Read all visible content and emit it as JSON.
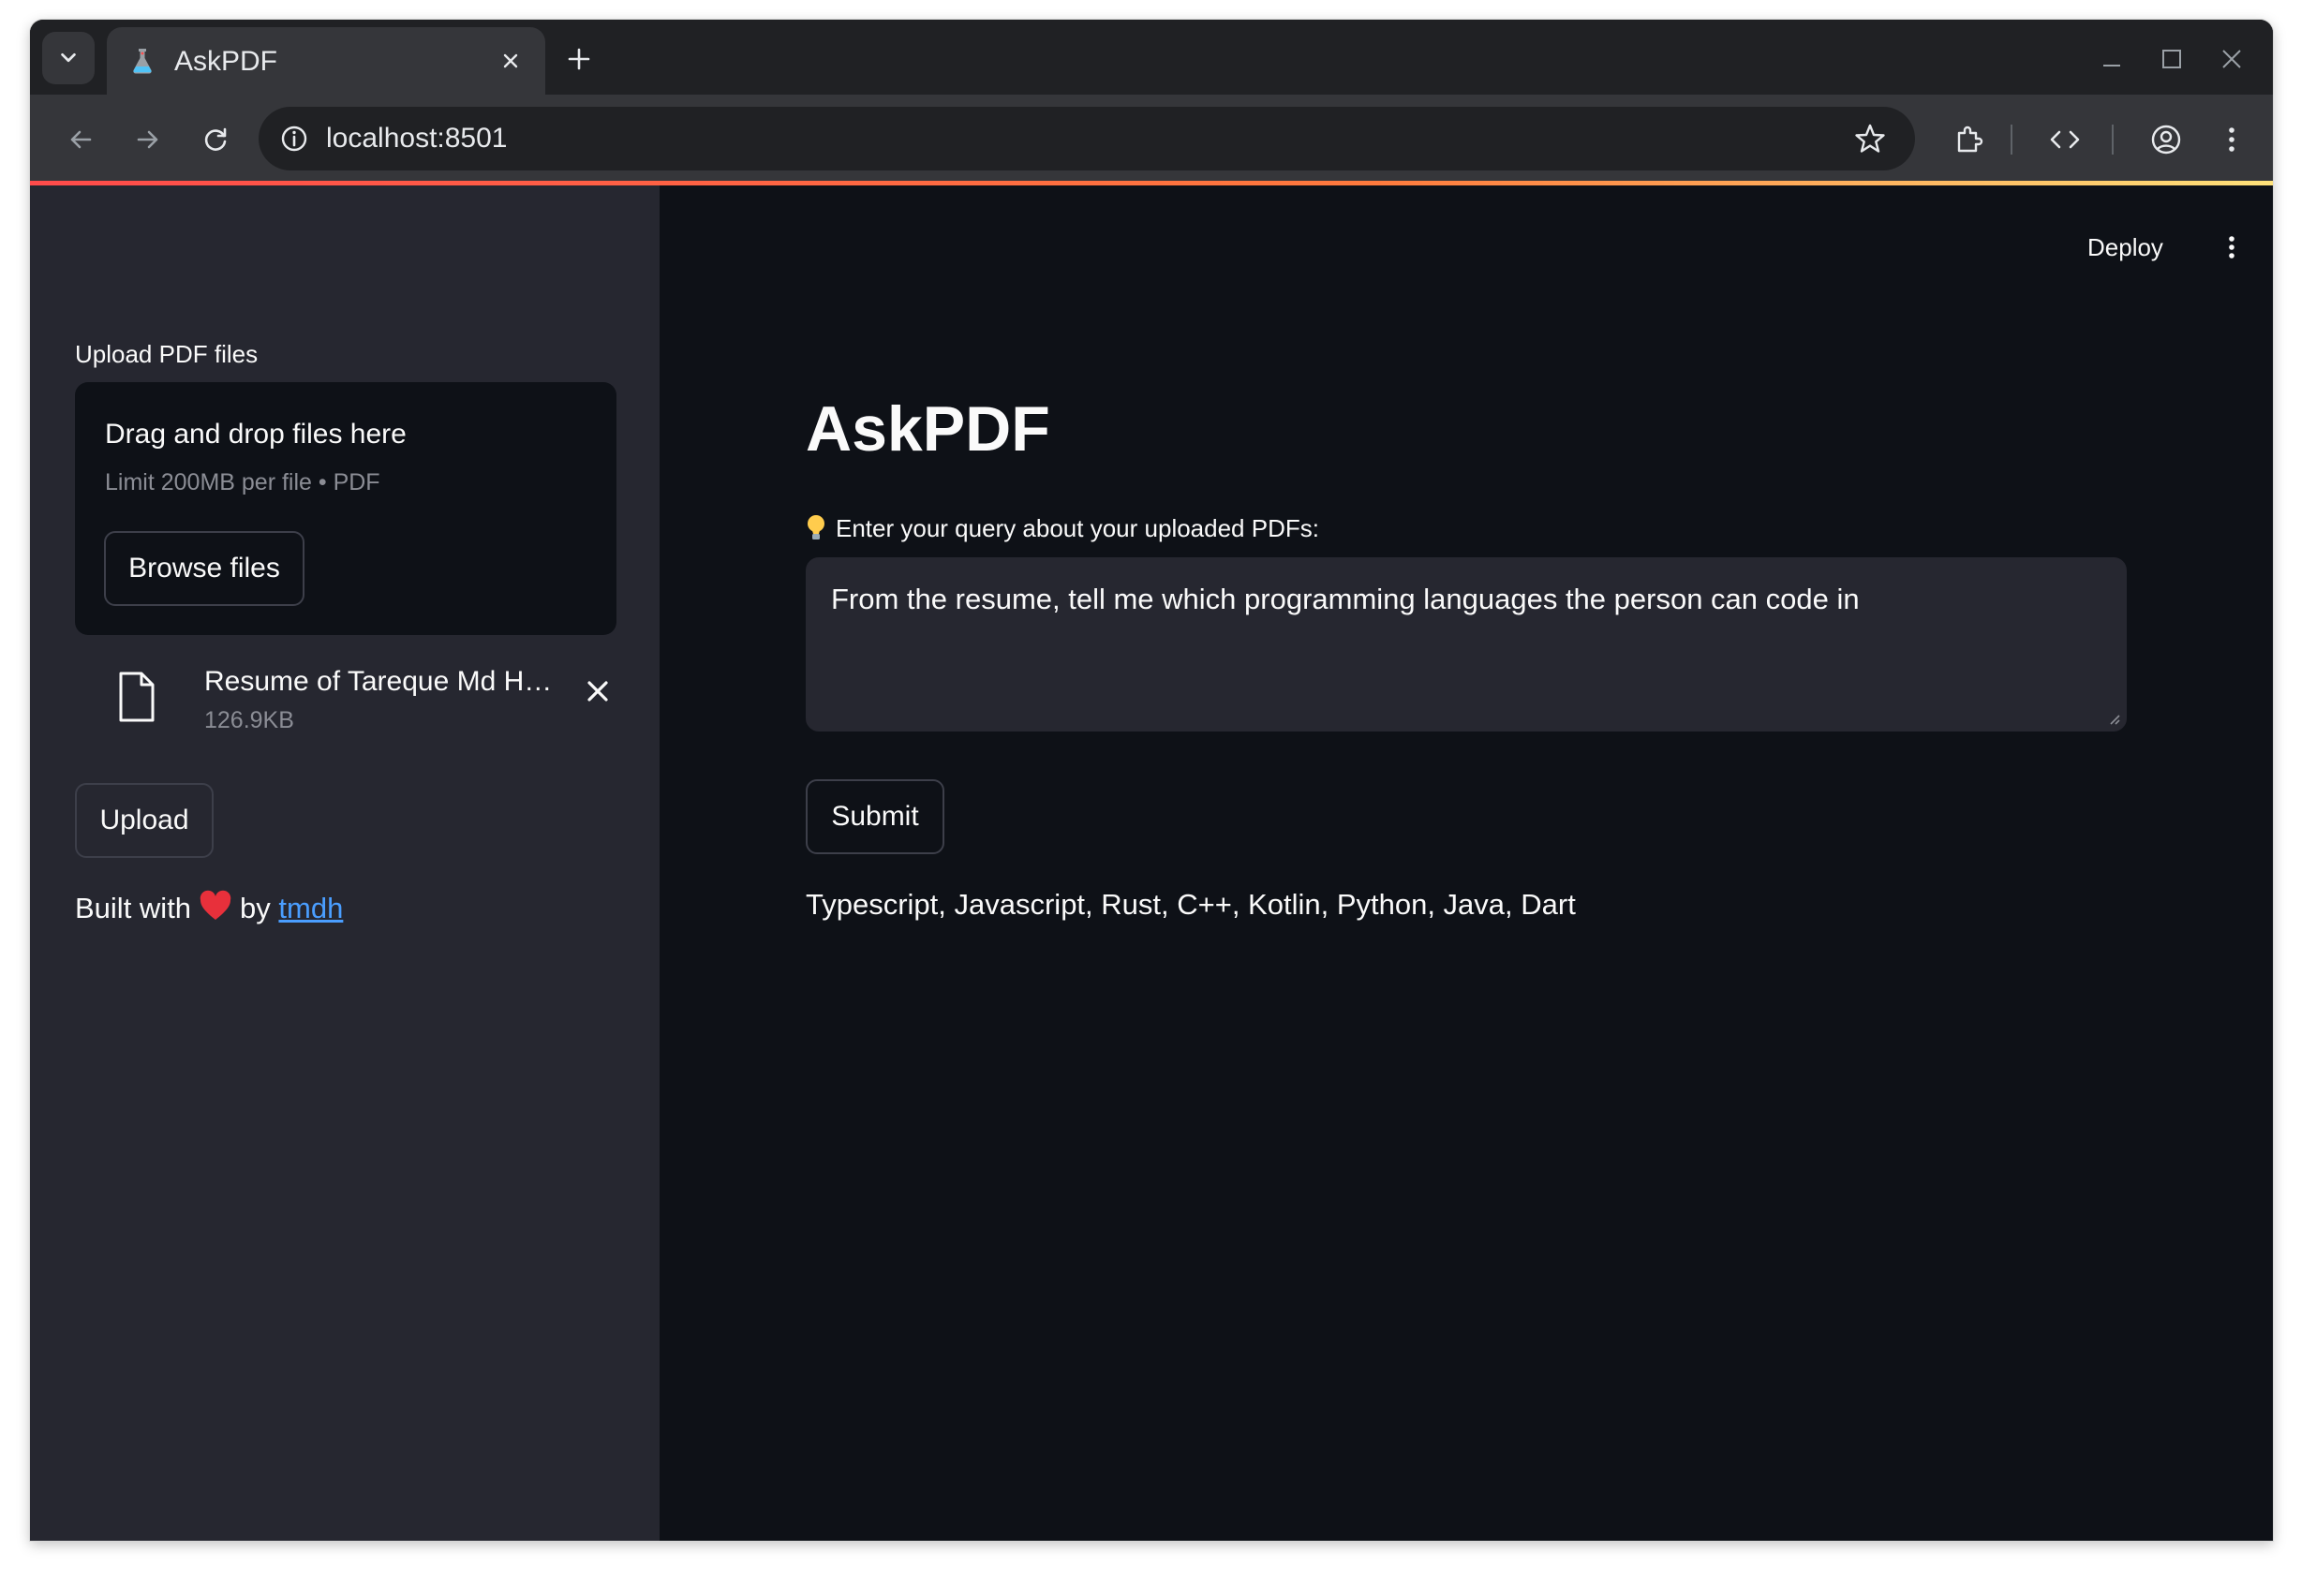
{
  "browser": {
    "tab_title": "AskPDF",
    "url": "localhost:8501"
  },
  "colors": {
    "accent": "#ff4b4b",
    "link": "#4a9eff",
    "sidebar_bg": "#262730",
    "main_bg": "#0e1117"
  },
  "header": {
    "deploy_label": "Deploy"
  },
  "sidebar": {
    "upload_label": "Upload PDF files",
    "dropzone": {
      "title": "Drag and drop files here",
      "limit_text": "Limit 200MB per file • PDF",
      "browse_label": "Browse files"
    },
    "file": {
      "name": "Resume of Tareque Md H…",
      "size": "126.9KB"
    },
    "upload_button_label": "Upload",
    "footer": {
      "prefix": "Built with",
      "by": "by",
      "author": "tmdh"
    }
  },
  "main": {
    "title": "AskPDF",
    "query_label": "Enter your query about your uploaded PDFs:",
    "query_value": "From the resume, tell me which programming languages the person can code in",
    "submit_label": "Submit",
    "answer": "Typescript, Javascript, Rust, C++, Kotlin, Python, Java, Dart"
  },
  "icons": [
    "chevron-down-icon",
    "flask-icon",
    "close-icon",
    "plus-icon",
    "minimize-icon",
    "maximize-icon",
    "back-icon",
    "forward-icon",
    "reload-icon",
    "info-icon",
    "star-icon",
    "extension-icon",
    "code-icon",
    "profile-icon",
    "more-vert-icon",
    "file-icon",
    "heart-icon",
    "lightbulb-icon"
  ]
}
